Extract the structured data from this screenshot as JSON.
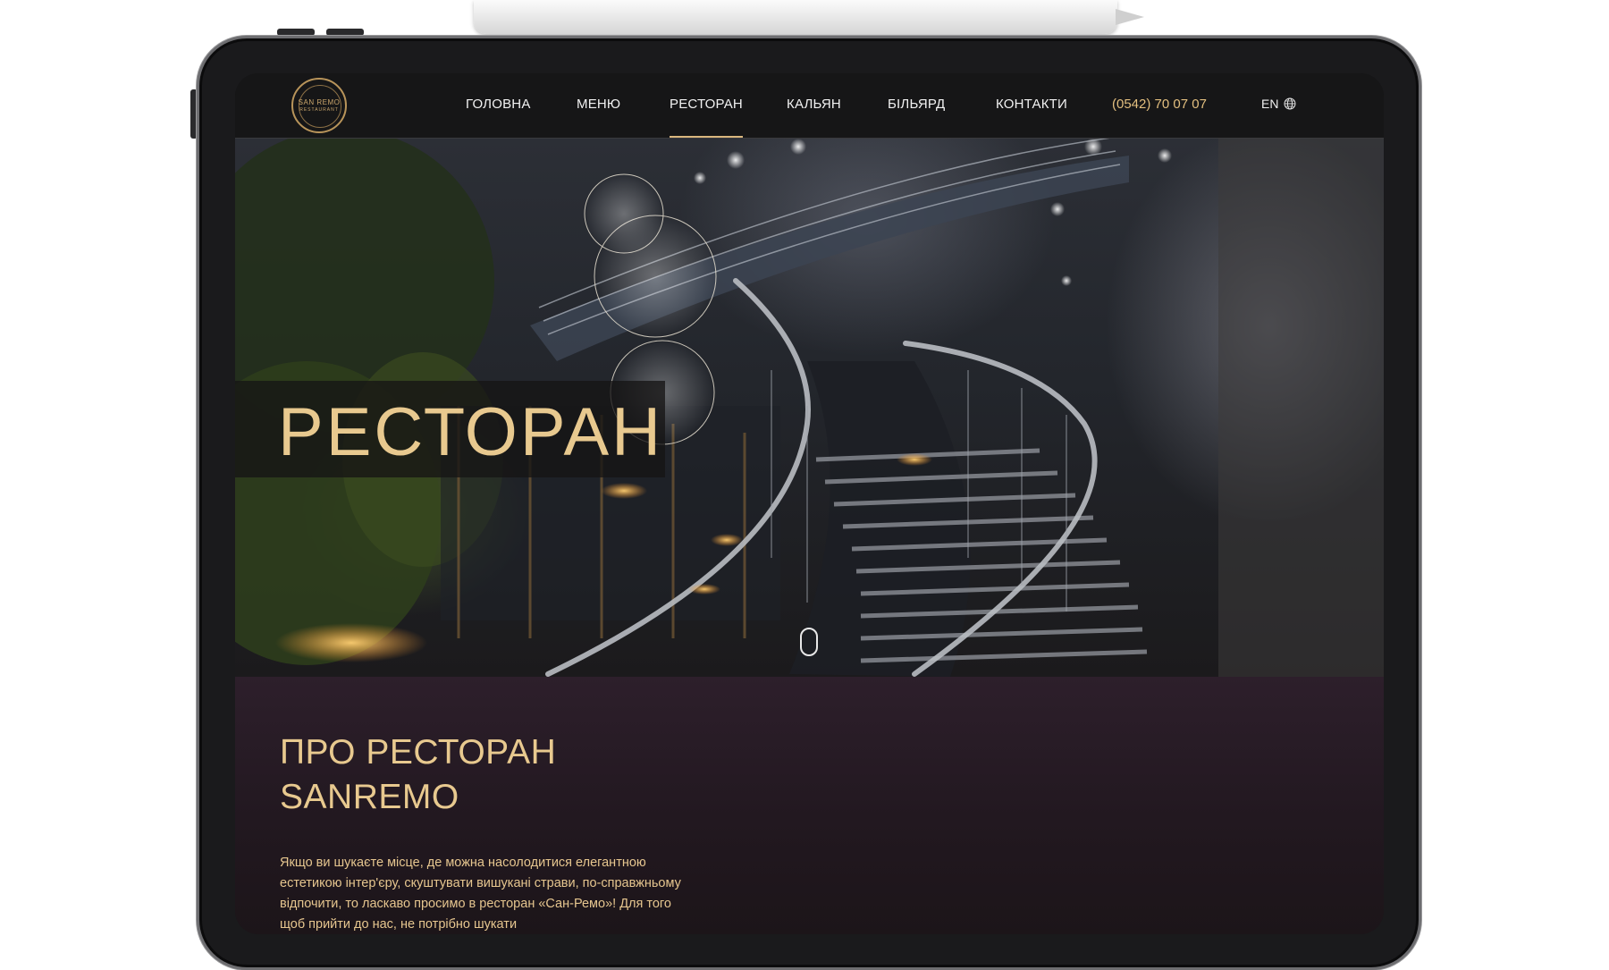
{
  "header": {
    "logo": {
      "name": "SAN REMO",
      "sub": "RESTAURANT"
    },
    "nav": [
      {
        "label": "ГОЛОВНА",
        "active": false
      },
      {
        "label": "МЕНЮ",
        "active": false
      },
      {
        "label": "РЕСТОРАН",
        "active": true
      },
      {
        "label": "КАЛЬЯН",
        "active": false
      },
      {
        "label": "БІЛЬЯРД",
        "active": false
      },
      {
        "label": "КОНТАКТИ",
        "active": false
      }
    ],
    "phone": "(0542) 70 07 07",
    "language": "EN",
    "language_icon": "globe-icon"
  },
  "hero": {
    "title": "РЕСТОРАН",
    "scroll_icon": "mouse-scroll-icon"
  },
  "about": {
    "title_line1": "ПРО РЕСТОРАН",
    "title_line2": "SANREMO",
    "text": "Якщо ви шукаєте місце, де можна насолодитися елегантною естетикою інтер'єру, скуштувати вишукані страви, по-справжньому відпочити, то ласкаво просимо в ресторан «Сан-Ремо»! Для того щоб прийти до нас, не потрібно шукати"
  },
  "colors": {
    "accent_gold": "#e8c98f",
    "header_bg": "#161617",
    "about_bg": "#2d1f2b"
  }
}
